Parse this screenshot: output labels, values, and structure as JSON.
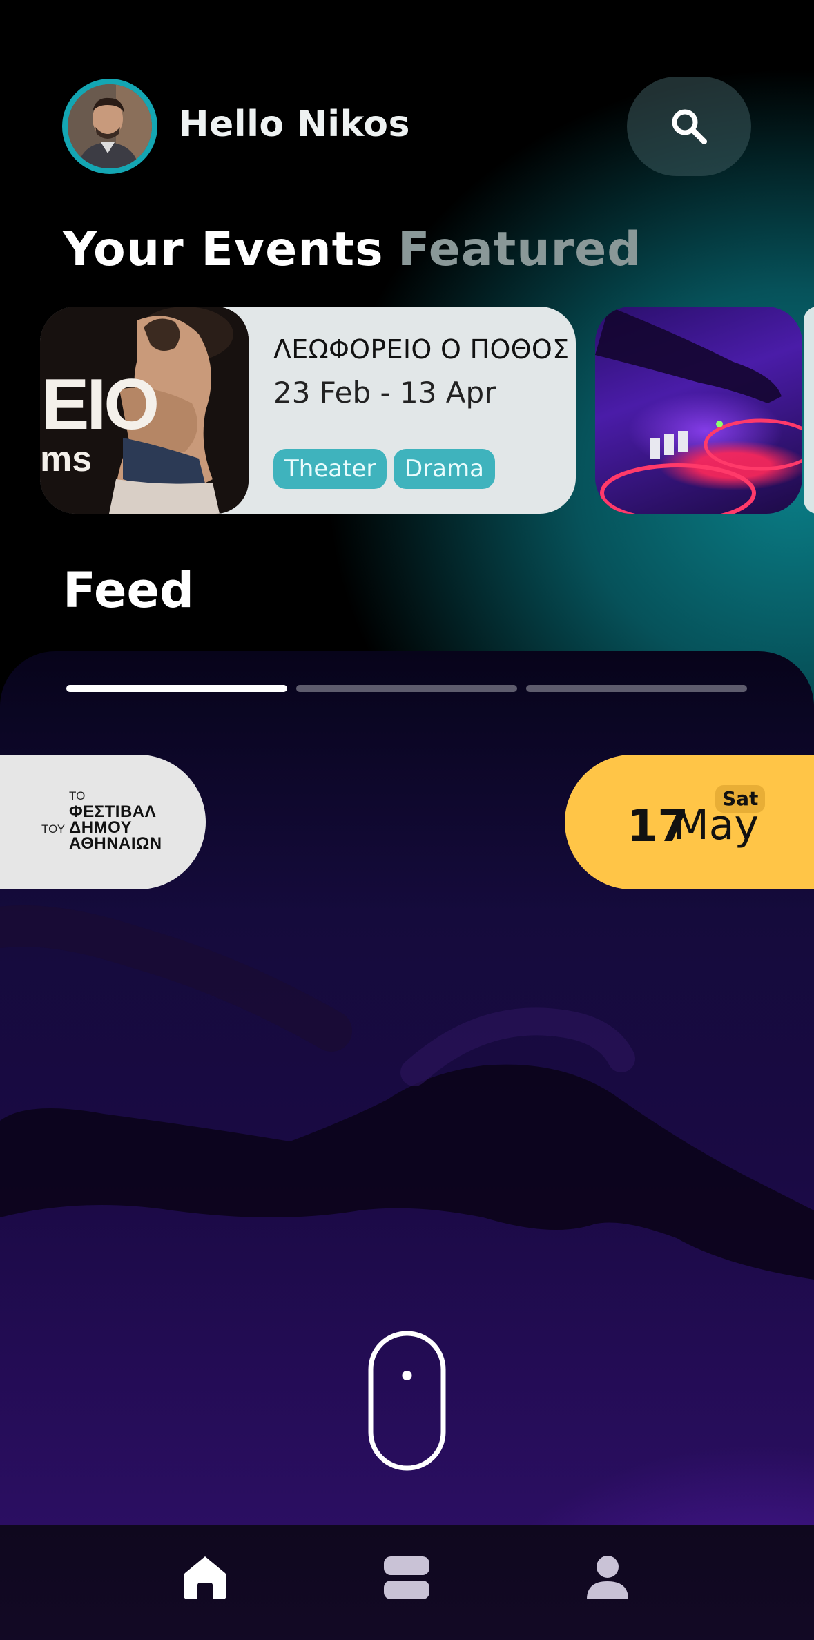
{
  "header": {
    "greeting": "Hello Nikos",
    "avatar_icon": "user-avatar",
    "search_icon": "search-icon"
  },
  "tabs": [
    {
      "label": "Your Events",
      "active": true
    },
    {
      "label": "Featured",
      "active": false
    }
  ],
  "events": [
    {
      "title": "ΛΕΩΦΟΡΕΙΟ Ο ΠΟΘΟΣ",
      "dates": "23 Feb - 13 Apr",
      "tags": [
        "Theater",
        "Drama"
      ],
      "thumb_text": "EIO",
      "thumb_text2": "ms"
    }
  ],
  "feed": {
    "heading": "Feed",
    "story_progress": [
      1,
      0,
      0
    ],
    "organizer": {
      "line1": "ΤΟ",
      "line2": "ΦΕΣΤΙΒΑΛ",
      "line3_small": "ΤΟΥ",
      "line3": "ΔΗΜΟΥ",
      "line4": "ΑΘΗΝΑΙΩΝ"
    },
    "date": {
      "day": "17",
      "month": "May",
      "weekday": "Sat"
    },
    "scroll_icon": "mouse-scroll-icon"
  },
  "nav": [
    {
      "icon": "home-icon",
      "active": true
    },
    {
      "icon": "events-icon",
      "active": false
    },
    {
      "icon": "profile-icon",
      "active": false
    }
  ],
  "colors": {
    "accent": "#14a6b3",
    "tag": "#3fb3bd",
    "date_pill": "#ffc547",
    "inactive_tab": "#8a9898"
  }
}
